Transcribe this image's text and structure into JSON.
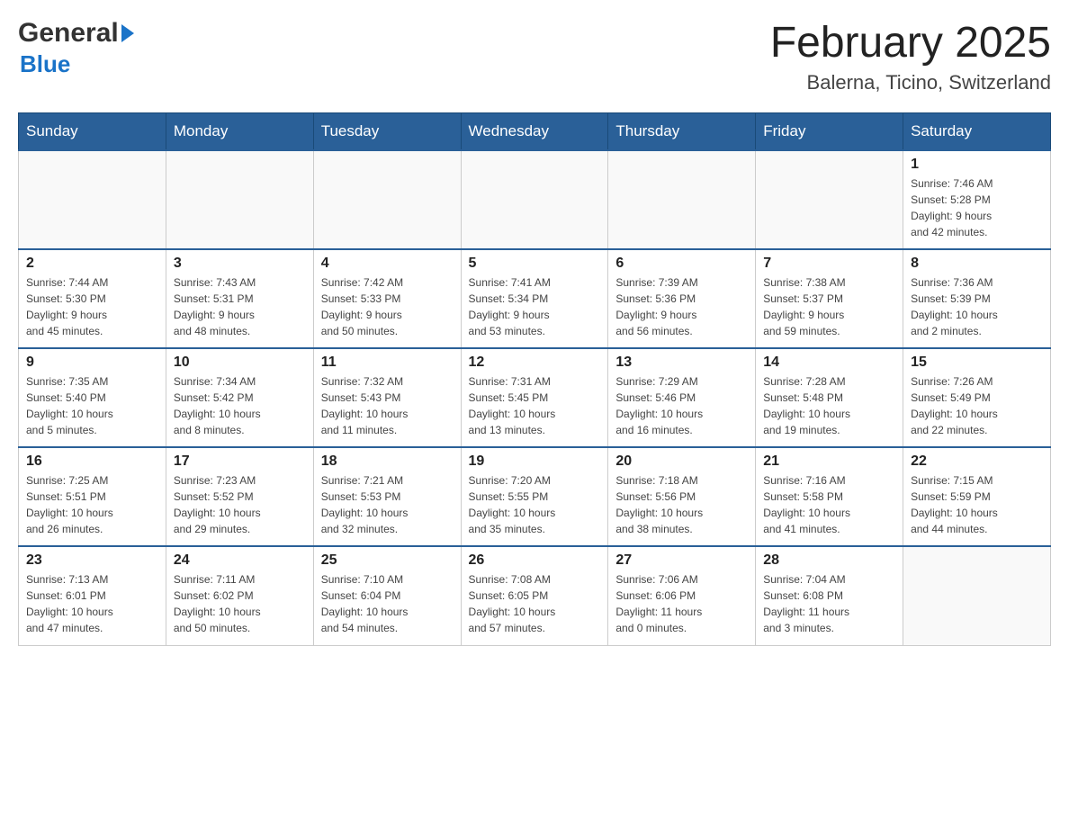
{
  "header": {
    "logo_general": "General",
    "logo_blue": "Blue",
    "title": "February 2025",
    "subtitle": "Balerna, Ticino, Switzerland"
  },
  "days_of_week": [
    "Sunday",
    "Monday",
    "Tuesday",
    "Wednesday",
    "Thursday",
    "Friday",
    "Saturday"
  ],
  "weeks": [
    {
      "days": [
        {
          "num": "",
          "info": ""
        },
        {
          "num": "",
          "info": ""
        },
        {
          "num": "",
          "info": ""
        },
        {
          "num": "",
          "info": ""
        },
        {
          "num": "",
          "info": ""
        },
        {
          "num": "",
          "info": ""
        },
        {
          "num": "1",
          "info": "Sunrise: 7:46 AM\nSunset: 5:28 PM\nDaylight: 9 hours\nand 42 minutes."
        }
      ]
    },
    {
      "days": [
        {
          "num": "2",
          "info": "Sunrise: 7:44 AM\nSunset: 5:30 PM\nDaylight: 9 hours\nand 45 minutes."
        },
        {
          "num": "3",
          "info": "Sunrise: 7:43 AM\nSunset: 5:31 PM\nDaylight: 9 hours\nand 48 minutes."
        },
        {
          "num": "4",
          "info": "Sunrise: 7:42 AM\nSunset: 5:33 PM\nDaylight: 9 hours\nand 50 minutes."
        },
        {
          "num": "5",
          "info": "Sunrise: 7:41 AM\nSunset: 5:34 PM\nDaylight: 9 hours\nand 53 minutes."
        },
        {
          "num": "6",
          "info": "Sunrise: 7:39 AM\nSunset: 5:36 PM\nDaylight: 9 hours\nand 56 minutes."
        },
        {
          "num": "7",
          "info": "Sunrise: 7:38 AM\nSunset: 5:37 PM\nDaylight: 9 hours\nand 59 minutes."
        },
        {
          "num": "8",
          "info": "Sunrise: 7:36 AM\nSunset: 5:39 PM\nDaylight: 10 hours\nand 2 minutes."
        }
      ]
    },
    {
      "days": [
        {
          "num": "9",
          "info": "Sunrise: 7:35 AM\nSunset: 5:40 PM\nDaylight: 10 hours\nand 5 minutes."
        },
        {
          "num": "10",
          "info": "Sunrise: 7:34 AM\nSunset: 5:42 PM\nDaylight: 10 hours\nand 8 minutes."
        },
        {
          "num": "11",
          "info": "Sunrise: 7:32 AM\nSunset: 5:43 PM\nDaylight: 10 hours\nand 11 minutes."
        },
        {
          "num": "12",
          "info": "Sunrise: 7:31 AM\nSunset: 5:45 PM\nDaylight: 10 hours\nand 13 minutes."
        },
        {
          "num": "13",
          "info": "Sunrise: 7:29 AM\nSunset: 5:46 PM\nDaylight: 10 hours\nand 16 minutes."
        },
        {
          "num": "14",
          "info": "Sunrise: 7:28 AM\nSunset: 5:48 PM\nDaylight: 10 hours\nand 19 minutes."
        },
        {
          "num": "15",
          "info": "Sunrise: 7:26 AM\nSunset: 5:49 PM\nDaylight: 10 hours\nand 22 minutes."
        }
      ]
    },
    {
      "days": [
        {
          "num": "16",
          "info": "Sunrise: 7:25 AM\nSunset: 5:51 PM\nDaylight: 10 hours\nand 26 minutes."
        },
        {
          "num": "17",
          "info": "Sunrise: 7:23 AM\nSunset: 5:52 PM\nDaylight: 10 hours\nand 29 minutes."
        },
        {
          "num": "18",
          "info": "Sunrise: 7:21 AM\nSunset: 5:53 PM\nDaylight: 10 hours\nand 32 minutes."
        },
        {
          "num": "19",
          "info": "Sunrise: 7:20 AM\nSunset: 5:55 PM\nDaylight: 10 hours\nand 35 minutes."
        },
        {
          "num": "20",
          "info": "Sunrise: 7:18 AM\nSunset: 5:56 PM\nDaylight: 10 hours\nand 38 minutes."
        },
        {
          "num": "21",
          "info": "Sunrise: 7:16 AM\nSunset: 5:58 PM\nDaylight: 10 hours\nand 41 minutes."
        },
        {
          "num": "22",
          "info": "Sunrise: 7:15 AM\nSunset: 5:59 PM\nDaylight: 10 hours\nand 44 minutes."
        }
      ]
    },
    {
      "days": [
        {
          "num": "23",
          "info": "Sunrise: 7:13 AM\nSunset: 6:01 PM\nDaylight: 10 hours\nand 47 minutes."
        },
        {
          "num": "24",
          "info": "Sunrise: 7:11 AM\nSunset: 6:02 PM\nDaylight: 10 hours\nand 50 minutes."
        },
        {
          "num": "25",
          "info": "Sunrise: 7:10 AM\nSunset: 6:04 PM\nDaylight: 10 hours\nand 54 minutes."
        },
        {
          "num": "26",
          "info": "Sunrise: 7:08 AM\nSunset: 6:05 PM\nDaylight: 10 hours\nand 57 minutes."
        },
        {
          "num": "27",
          "info": "Sunrise: 7:06 AM\nSunset: 6:06 PM\nDaylight: 11 hours\nand 0 minutes."
        },
        {
          "num": "28",
          "info": "Sunrise: 7:04 AM\nSunset: 6:08 PM\nDaylight: 11 hours\nand 3 minutes."
        },
        {
          "num": "",
          "info": ""
        }
      ]
    }
  ]
}
